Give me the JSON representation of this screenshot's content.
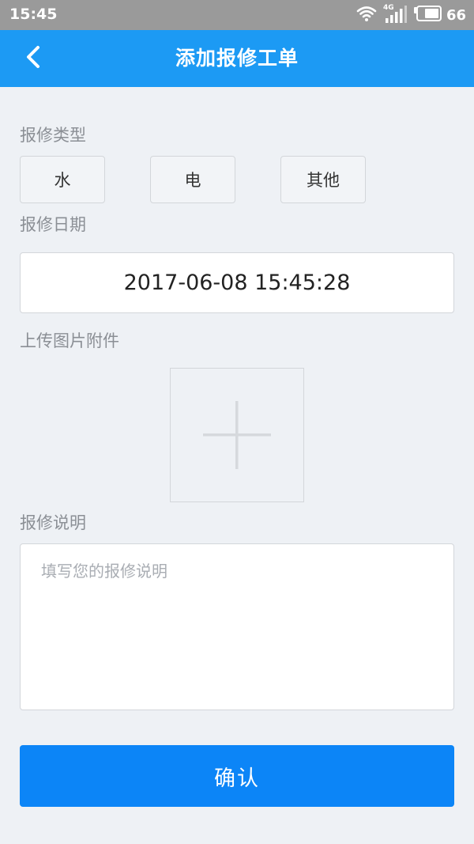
{
  "status_bar": {
    "time": "15:45",
    "network_label": "4G",
    "battery_level": "66",
    "icons": [
      "wifi-icon",
      "signal-icon",
      "battery-icon"
    ]
  },
  "header": {
    "back_icon": "chevron-left-icon",
    "title": "添加报修工单"
  },
  "form": {
    "type_label": "报修类型",
    "types": [
      "水",
      "电",
      "其他"
    ],
    "date_label": "报修日期",
    "date_value": "2017-06-08 15:45:28",
    "upload_label": "上传图片附件",
    "upload_icon": "plus-icon",
    "description_label": "报修说明",
    "description_placeholder": "填写您的报修说明",
    "description_value": "",
    "submit_label": "确认"
  },
  "colors": {
    "header_bg": "#1c9af4",
    "button_bg": "#0c85f7",
    "page_bg": "#eef1f5",
    "status_bar_bg": "#9a9a9a"
  }
}
